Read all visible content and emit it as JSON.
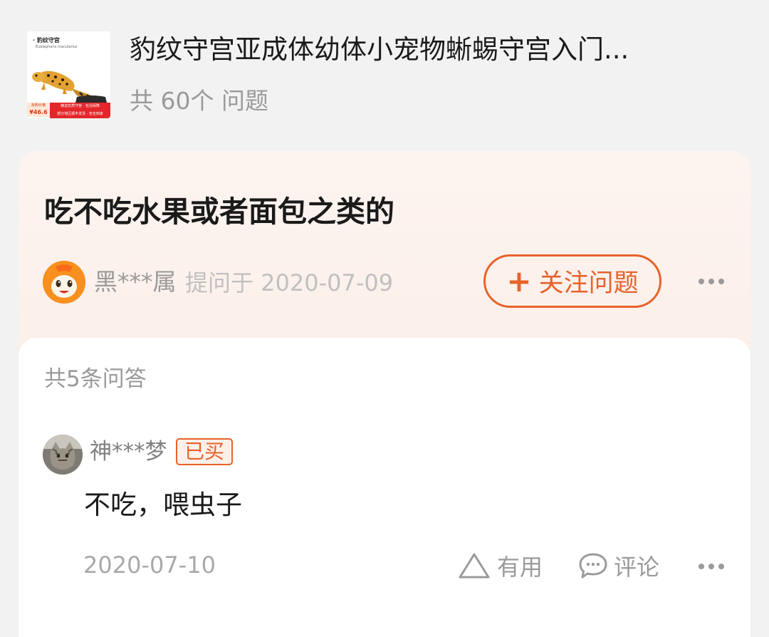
{
  "product": {
    "title": "豹纹守宫亚成体幼体小宠物蜥蜴守宫入门...",
    "question_count": "共 60个 问题",
    "thumbnail": {
      "brand_text": "· 豹纹守宫",
      "sub_text": "Eublepharis macularius",
      "price_label": "抢购价格",
      "price": "¥46.6",
      "banner_line1": "精选优质守宫 · 包活保障",
      "banner_line2": "部分地区顺丰发货 · 安全到家"
    }
  },
  "question": {
    "title": "吃不吃水果或者面包之类的",
    "asker_name": "黑***属",
    "asked_on": "提问于 2020-07-09",
    "follow_button_label": "关注问题",
    "follow_icon": "plus-icon"
  },
  "answers": {
    "count_label": "共5条问答",
    "items": [
      {
        "author": "神***梦",
        "badge": "已买",
        "text": "不吃，喂虫子",
        "date": "2020-07-10",
        "useful_label": "有用",
        "comment_label": "评论"
      }
    ]
  },
  "colors": {
    "accent": "#e8622a",
    "page_bg": "#f2f2f2",
    "question_card_bg": "#fcefe9",
    "muted_text": "#9a9a9a"
  }
}
